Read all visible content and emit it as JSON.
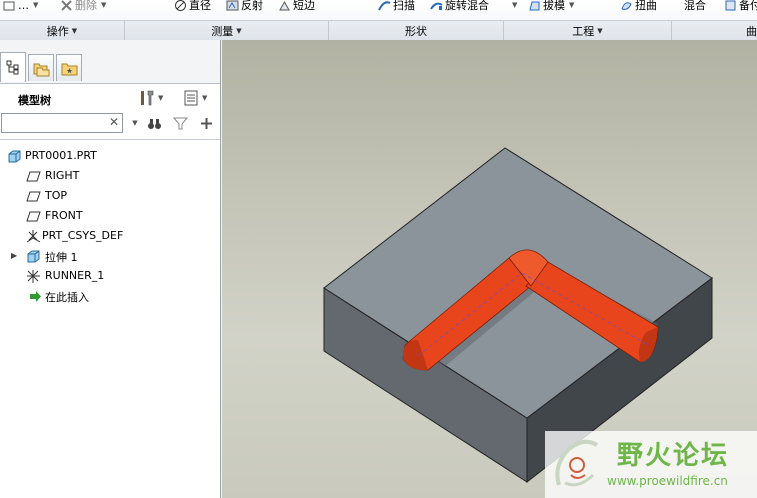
{
  "ribbon": {
    "tools": [
      {
        "id": "ops-top",
        "label": "…",
        "icon": "edit-icon"
      },
      {
        "id": "delete",
        "label": "删除",
        "icon": "delete-x-icon"
      },
      {
        "id": "diameter",
        "label": "直径",
        "icon": "diameter-icon"
      },
      {
        "id": "reflect",
        "label": "反射",
        "icon": "reflect-icon"
      },
      {
        "id": "short-edge",
        "label": "短边",
        "icon": "short-edge-icon"
      },
      {
        "id": "sweep",
        "label": "扫描",
        "icon": "sweep-icon"
      },
      {
        "id": "swept-blend",
        "label": "旋转混合",
        "icon": "swept-blend-icon"
      },
      {
        "id": "draft",
        "label": "拔模",
        "icon": "draft-icon"
      },
      {
        "id": "twist",
        "label": "扭曲",
        "icon": "twist-icon"
      },
      {
        "id": "blend",
        "label": "混合",
        "icon": ""
      },
      {
        "id": "backup",
        "label": "备付",
        "icon": "backup-icon"
      }
    ],
    "groups": {
      "operations": "操作",
      "measure": "测量",
      "shape": "形状",
      "engineering": "工程",
      "surface": "曲"
    }
  },
  "panel": {
    "tabs": [
      "model-tree-tab",
      "folder-browser-tab",
      "favorites-tab"
    ],
    "tree_title": "模型树",
    "search": {
      "value": "",
      "placeholder": ""
    }
  },
  "tree": {
    "items": [
      {
        "label": "PRT0001.PRT",
        "icon": "part-icon"
      },
      {
        "label": "RIGHT",
        "icon": "datum-plane-icon"
      },
      {
        "label": "TOP",
        "icon": "datum-plane-icon"
      },
      {
        "label": "FRONT",
        "icon": "datum-plane-icon"
      },
      {
        "label": "PRT_CSYS_DEF",
        "icon": "csys-icon"
      },
      {
        "label": "拉伸 1",
        "icon": "extrude-icon"
      },
      {
        "label": "RUNNER_1",
        "icon": "runner-icon"
      },
      {
        "label": "在此插入",
        "icon": "insert-here-icon"
      }
    ]
  },
  "watermark": {
    "title": "野火论坛",
    "url": "www.proewildfire.cn"
  },
  "colors": {
    "runner": "#e8451c",
    "block_top": "#8b939b",
    "block_front": "#63696f",
    "block_right": "#41464b",
    "watermark_green": "#6fb64a"
  }
}
